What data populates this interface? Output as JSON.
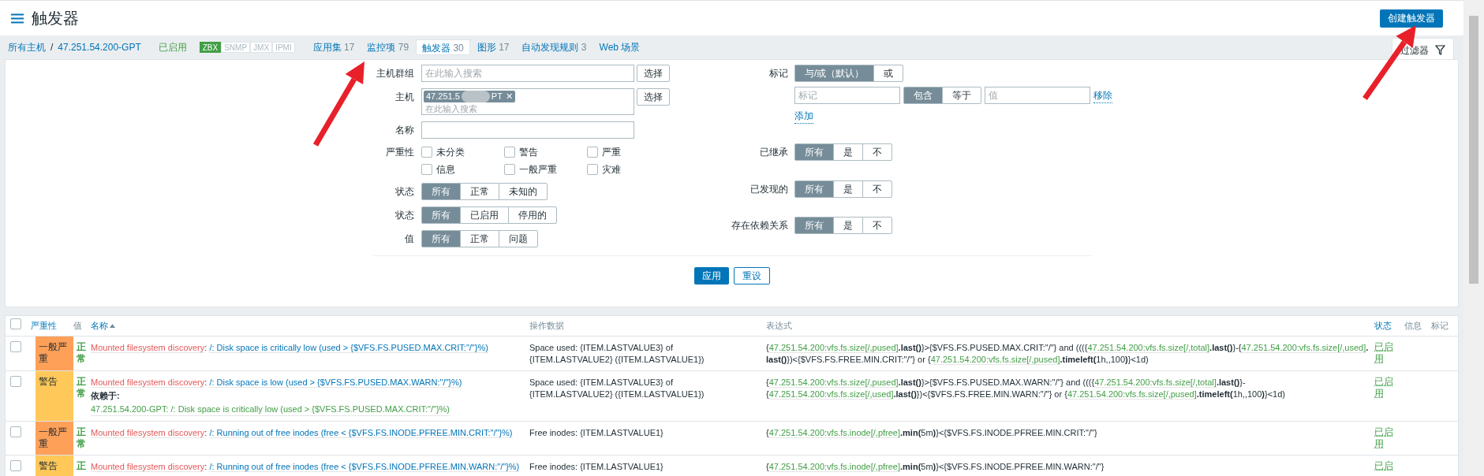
{
  "header": {
    "title": "触发器",
    "create_button": "创建触发器"
  },
  "nav": {
    "breadcrumbs": [
      "所有主机",
      "/",
      "47.251.54.200-GPT"
    ],
    "status": "已启用",
    "availability": [
      {
        "label": "ZBX",
        "selected": true
      },
      {
        "label": "SNMP",
        "selected": false
      },
      {
        "label": "JMX",
        "selected": false
      },
      {
        "label": "IPMI",
        "selected": false
      }
    ],
    "tabs": [
      {
        "label": "应用集",
        "count": "17",
        "selected": false
      },
      {
        "label": "监控项",
        "count": "79",
        "selected": false
      },
      {
        "label": "触发器",
        "count": "30",
        "selected": true
      },
      {
        "label": "图形",
        "count": "17",
        "selected": false
      },
      {
        "label": "自动发现规则",
        "count": "3",
        "selected": false
      },
      {
        "label": "Web 场景",
        "selected": false
      }
    ],
    "filter_tab": "过滤器"
  },
  "filter": {
    "host_group": {
      "label": "主机群组",
      "placeholder": "在此输入搜索",
      "button": "选择"
    },
    "host": {
      "label": "主机",
      "tag_start": "47.251.5",
      "tag_end": "PT",
      "tag_remove": "✕",
      "placeholder": "在此输入搜索",
      "button": "选择"
    },
    "name": {
      "label": "名称"
    },
    "severity": {
      "label": "严重性",
      "options": [
        {
          "label": "未分类",
          "checked": false
        },
        {
          "label": "警告",
          "checked": false
        },
        {
          "label": "严重",
          "checked": false
        },
        {
          "label": "信息",
          "checked": false
        },
        {
          "label": "一般严重",
          "checked": false
        },
        {
          "label": "灾难",
          "checked": false
        }
      ]
    },
    "left_groups": [
      {
        "label": "状态",
        "options": [
          {
            "label": "所有",
            "selected": true
          },
          {
            "label": "正常",
            "selected": false
          },
          {
            "label": "未知的",
            "selected": false
          }
        ]
      },
      {
        "label": "状态",
        "options": [
          {
            "label": "所有",
            "selected": true
          },
          {
            "label": "已启用",
            "selected": false
          },
          {
            "label": "停用的",
            "selected": false
          }
        ]
      },
      {
        "label": "值",
        "options": [
          {
            "label": "所有",
            "selected": true
          },
          {
            "label": "正常",
            "selected": false
          },
          {
            "label": "问题",
            "selected": false
          }
        ]
      }
    ],
    "tags": {
      "label": "标记",
      "operators": [
        {
          "label": "与/或（默认）",
          "selected": true
        },
        {
          "label": "或",
          "selected": false
        }
      ],
      "tag_placeholder": "标记",
      "match": [
        {
          "label": "包含",
          "selected": true
        },
        {
          "label": "等于",
          "selected": false
        }
      ],
      "value_placeholder": "值",
      "remove": "移除",
      "add": "添加"
    },
    "right_groups": [
      {
        "label": "已继承",
        "options": [
          {
            "label": "所有",
            "selected": true
          },
          {
            "label": "是",
            "selected": false
          },
          {
            "label": "不",
            "selected": false
          }
        ]
      },
      {
        "label": "已发现的",
        "options": [
          {
            "label": "所有",
            "selected": true
          },
          {
            "label": "是",
            "selected": false
          },
          {
            "label": "不",
            "selected": false
          }
        ]
      },
      {
        "label": "存在依赖关系",
        "options": [
          {
            "label": "所有",
            "selected": true
          },
          {
            "label": "是",
            "selected": false
          },
          {
            "label": "不",
            "selected": false
          }
        ]
      }
    ],
    "apply": "应用",
    "reset": "重设"
  },
  "table": {
    "select_all": {
      "checked": false
    },
    "columns": [
      {
        "label": "严重性",
        "sortable": true,
        "sorted": false
      },
      {
        "label": "值",
        "sortable": false,
        "sorted": false
      },
      {
        "label": "名称",
        "sortable": true,
        "sorted": true
      },
      {
        "label": "操作数据",
        "sortable": false,
        "sorted": false
      },
      {
        "label": "表达式",
        "sortable": false,
        "sorted": false
      },
      {
        "label": "状态",
        "sortable": true,
        "sorted": false
      },
      {
        "label": "信息",
        "sortable": false,
        "sorted": false
      },
      {
        "label": "标记",
        "sortable": false,
        "sorted": false
      }
    ],
    "rows": [
      {
        "checked": false,
        "severity": "一般严重",
        "color": "#ffa059",
        "value": "正常",
        "discovery": "Mounted filesystem discovery",
        "separator": ":",
        "name": "/: Disk space is critically low (used > {$VFS.FS.PUSED.MAX.CRIT:\"/\"}%)",
        "operational": "Space used: {ITEM.LASTVALUE3} of {ITEM.LASTVALUE2} ({ITEM.LASTVALUE1})",
        "expression": [
          {
            "kind": "text",
            "text": "{"
          },
          {
            "kind": "link",
            "text": "47.251.54.200:vfs.fs.size[/,pused]"
          },
          {
            "kind": "bold",
            "text": ".last()"
          },
          {
            "kind": "text",
            "text": "}>{$VFS.FS.PUSED.MAX.CRIT:\"/\"} and ((({"
          },
          {
            "kind": "link",
            "text": "47.251.54.200:vfs.fs.size[/,total]"
          },
          {
            "kind": "bold",
            "text": ".last()"
          },
          {
            "kind": "text",
            "text": "}-{"
          },
          {
            "kind": "link",
            "text": "47.251.54.200:vfs.fs.size[/,used]"
          },
          {
            "kind": "bold",
            "text": ".last()"
          },
          {
            "kind": "text",
            "text": "})<{$VFS.FS.FREE.MIN.CRIT:\"/\"} or {"
          },
          {
            "kind": "link",
            "text": "47.251.54.200:vfs.fs.size[/,pused]"
          },
          {
            "kind": "bold",
            "text": ".timeleft("
          },
          {
            "kind": "text",
            "text": "1h,,100"
          },
          {
            "kind": "bold",
            "text": ")"
          },
          {
            "kind": "text",
            "text": "}<1d)"
          }
        ],
        "status": "已启用"
      },
      {
        "checked": false,
        "severity": "警告",
        "color": "#ffc859",
        "value": "正常",
        "discovery": "Mounted filesystem discovery",
        "separator": ":",
        "name": "/: Disk space is low (used > {$VFS.FS.PUSED.MAX.WARN:\"/\"}%)",
        "depends_label": "依赖于:",
        "depends": "47.251.54.200-GPT: /: Disk space is critically low (used > {$VFS.FS.PUSED.MAX.CRIT:\"/\"}%)",
        "operational": "Space used: {ITEM.LASTVALUE3} of {ITEM.LASTVALUE2} ({ITEM.LASTVALUE1})",
        "expression": [
          {
            "kind": "text",
            "text": "{"
          },
          {
            "kind": "link",
            "text": "47.251.54.200:vfs.fs.size[/,pused]"
          },
          {
            "kind": "bold",
            "text": ".last()"
          },
          {
            "kind": "text",
            "text": "}>{$VFS.FS.PUSED.MAX.WARN:\"/\"} and ((({"
          },
          {
            "kind": "link",
            "text": "47.251.54.200:vfs.fs.size[/,total]"
          },
          {
            "kind": "bold",
            "text": ".last()"
          },
          {
            "kind": "text",
            "text": "}-{"
          },
          {
            "kind": "link",
            "text": "47.251.54.200:vfs.fs.size[/,used]"
          },
          {
            "kind": "bold",
            "text": ".last()"
          },
          {
            "kind": "text",
            "text": "})<{$VFS.FS.FREE.MIN.WARN:\"/\"} or {"
          },
          {
            "kind": "link",
            "text": "47.251.54.200:vfs.fs.size[/,pused]"
          },
          {
            "kind": "bold",
            "text": ".timeleft("
          },
          {
            "kind": "text",
            "text": "1h,,100"
          },
          {
            "kind": "bold",
            "text": ")"
          },
          {
            "kind": "text",
            "text": "}<1d)"
          }
        ],
        "status": "已启用"
      },
      {
        "checked": false,
        "severity": "一般严重",
        "color": "#ffa059",
        "value": "正常",
        "discovery": "Mounted filesystem discovery",
        "separator": ":",
        "name": "/: Running out of free inodes (free < {$VFS.FS.INODE.PFREE.MIN.CRIT:\"/\"}%)",
        "operational": "Free inodes: {ITEM.LASTVALUE1}",
        "expression": [
          {
            "kind": "text",
            "text": "{"
          },
          {
            "kind": "link",
            "text": "47.251.54.200:vfs.fs.inode[/,pfree]"
          },
          {
            "kind": "bold",
            "text": ".min("
          },
          {
            "kind": "text",
            "text": "5m"
          },
          {
            "kind": "bold",
            "text": ")"
          },
          {
            "kind": "text",
            "text": "}<{$VFS.FS.INODE.PFREE.MIN.CRIT:\"/\"}"
          }
        ],
        "status": "已启用"
      },
      {
        "checked": false,
        "severity": "警告",
        "color": "#ffc859",
        "value": "正",
        "discovery": "Mounted filesystem discovery",
        "separator": ":",
        "name": "/: Running out of free inodes (free < {$VFS.FS.INODE.PFREE.MIN.WARN:\"/\"}%)",
        "operational": "Free inodes: {ITEM.LASTVALUE1}",
        "expression": [
          {
            "kind": "text",
            "text": "{"
          },
          {
            "kind": "link",
            "text": "47.251.54.200:vfs.fs.inode[/,pfree]"
          },
          {
            "kind": "bold",
            "text": ".min("
          },
          {
            "kind": "text",
            "text": "5m"
          },
          {
            "kind": "bold",
            "text": ")"
          },
          {
            "kind": "text",
            "text": "}<{$VFS.FS.INODE.PFREE.MIN.WARN:\"/\"}"
          }
        ],
        "status": "已启"
      }
    ]
  }
}
